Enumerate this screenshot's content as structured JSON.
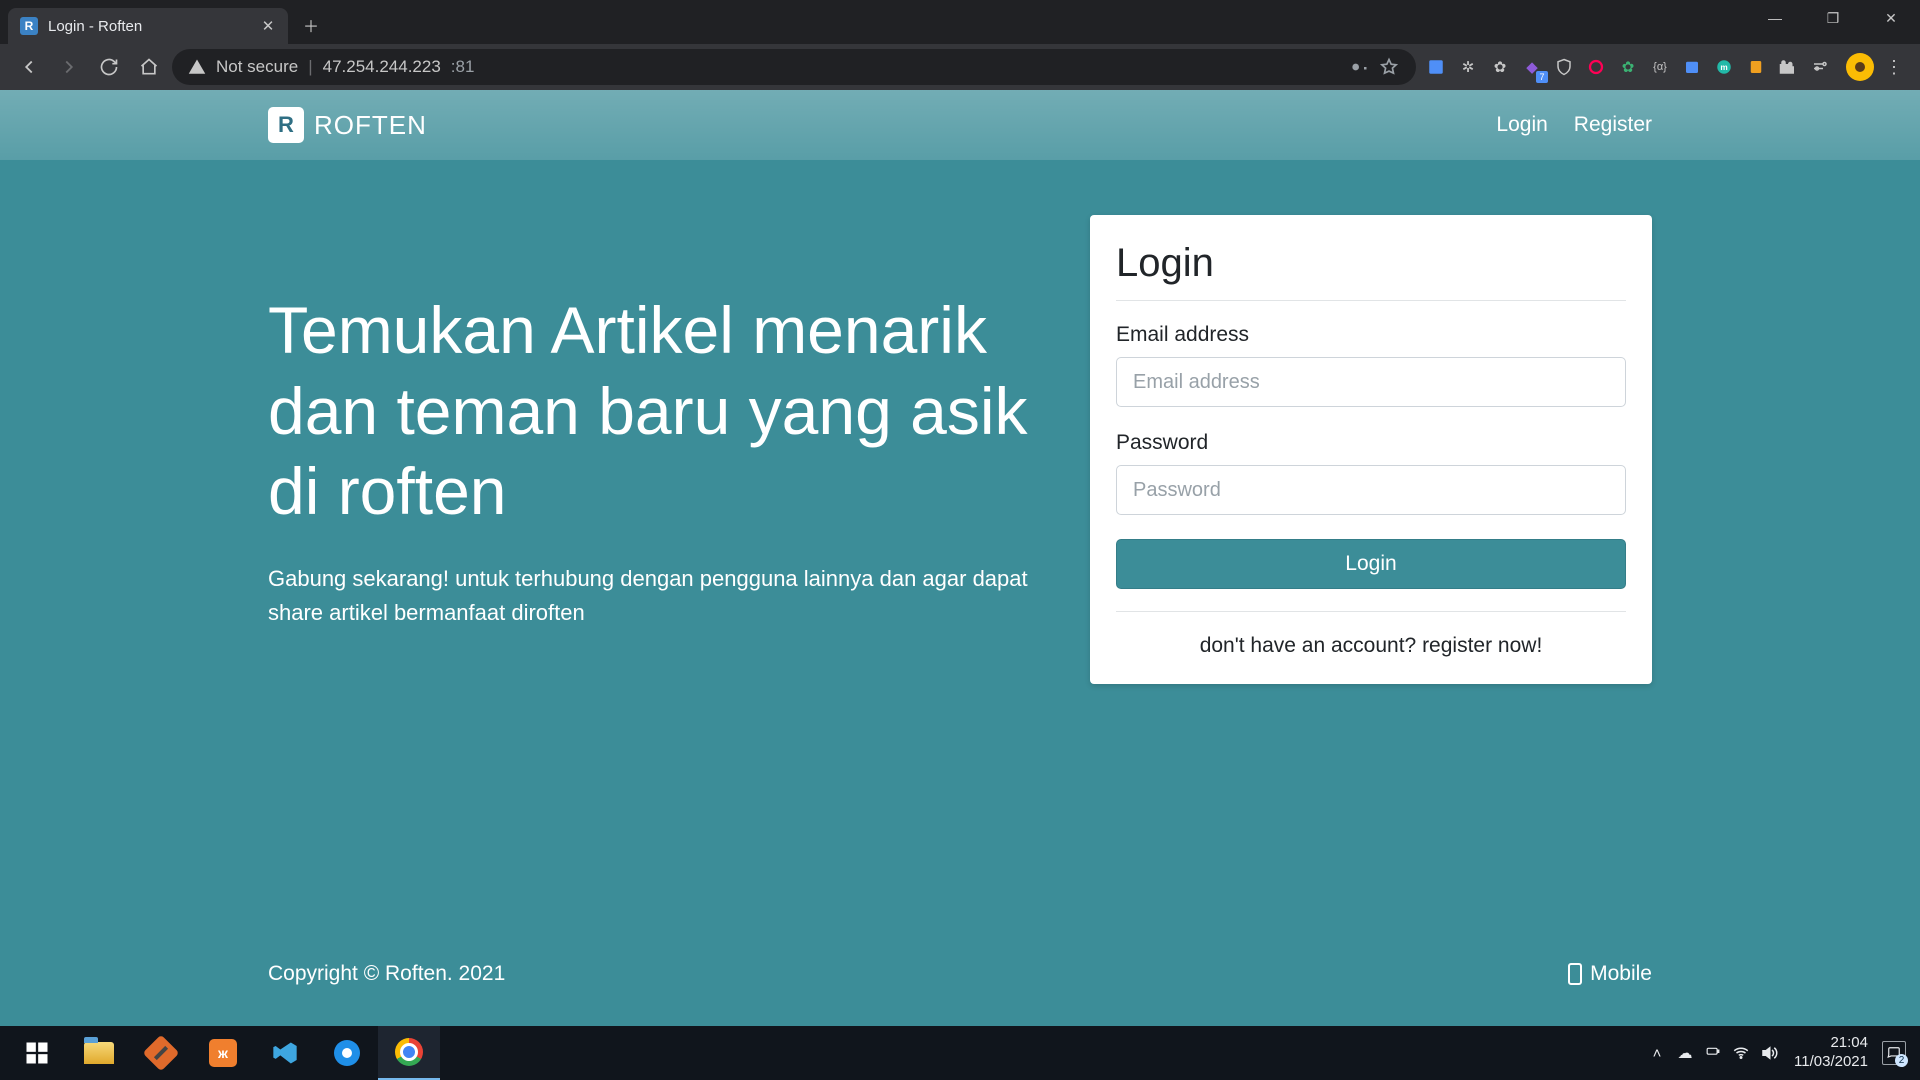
{
  "browser": {
    "tab_title": "Login - Roften",
    "favicon_letter": "R",
    "security_label": "Not secure",
    "url_host": "47.254.244.223",
    "url_port": ":81",
    "extension_badge": "7"
  },
  "nav": {
    "brand_letter": "R",
    "brand_name": "ROFTEN",
    "links": {
      "login": "Login",
      "register": "Register"
    }
  },
  "hero": {
    "headline": "Temukan Artikel menarik dan teman baru yang asik di roften",
    "subhead": "Gabung sekarang! untuk terhubung dengan pengguna lainnya dan agar dapat share artikel bermanfaat diroften"
  },
  "login_form": {
    "title": "Login",
    "email_label": "Email address",
    "email_placeholder": "Email address",
    "password_label": "Password",
    "password_placeholder": "Password",
    "submit_label": "Login",
    "register_prompt": "don't have an account? ",
    "register_link": "register now!"
  },
  "footer": {
    "copyright": "Copyright © Roften. 2021",
    "mobile_label": "Mobile"
  },
  "taskbar": {
    "time": "21:04",
    "date": "11/03/2021",
    "notif_count": "2",
    "xampp_letter": "ж"
  }
}
